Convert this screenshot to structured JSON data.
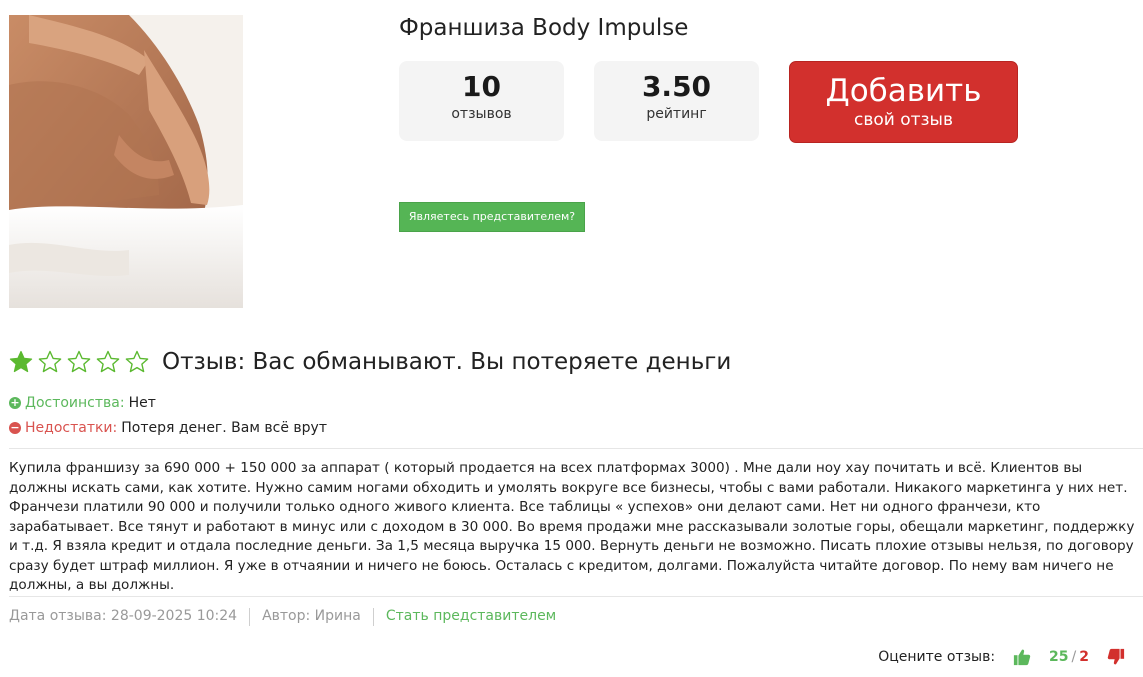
{
  "franchise": {
    "title": "Франшиза Body Impulse",
    "image_alt": "massage"
  },
  "stats": {
    "reviews_count": "10",
    "reviews_label": "отзывов",
    "rating_value": "3.50",
    "rating_label": "рейтинг"
  },
  "add_review": {
    "line1": "Добавить",
    "line2": "свой отзыв"
  },
  "representative_button": "Являетесь представителем?",
  "review": {
    "rating": 1,
    "max_rating": 5,
    "title": "Отзыв: Вас обманывают. Вы потеряете деньги",
    "pros_label": "Достоинства:",
    "pros_value": "Нет",
    "cons_label": "Недостатки:",
    "cons_value": "Потеря денег. Вам всё врут",
    "text": "Купила франшизу за 690 000 + 150 000 за аппарат ( который продается на всех платформах 3000) . Мне дали ноу хау почитать и всё. Клиентов вы должны искать сами, как хотите. Нужно самим ногами обходить и умолять вокруге все бизнесы, чтобы с вами работали. Никакого маркетинга у них нет. Франчези платили 90 000 и получили только одного живого клиента. Все таблицы « успехов» они делают сами. Нет ни одного франчези, кто зарабатывает. Все тянут и работают в минус или с доходом в 30 000. Во время продажи мне рассказывали золотые горы, обещали маркетинг, поддержку и т.д. Я взяла кредит и отдала последние деньги. За 1,5 месяца выручка 15 000. Вернуть деньги не возможно. Писать плохие отзывы нельзя, по договору сразу будет штраф миллион. Я уже в отчаянии и ничего не боюсь. Осталась с кредитом, долгами. Пожалуйста читайте договор. По нему вам ничего не должны, а вы должны.",
    "date": "Дата отзыва: 28-09-2025 10:24",
    "author": "Автор: Ирина",
    "become_representative": "Стать представителем"
  },
  "vote": {
    "prompt": "Оцените отзыв:",
    "up": "25",
    "separator": "/",
    "down": "2"
  },
  "colors": {
    "accent_green": "#5cb85c",
    "button_red": "#d2302d",
    "star_green": "#5bb930"
  }
}
